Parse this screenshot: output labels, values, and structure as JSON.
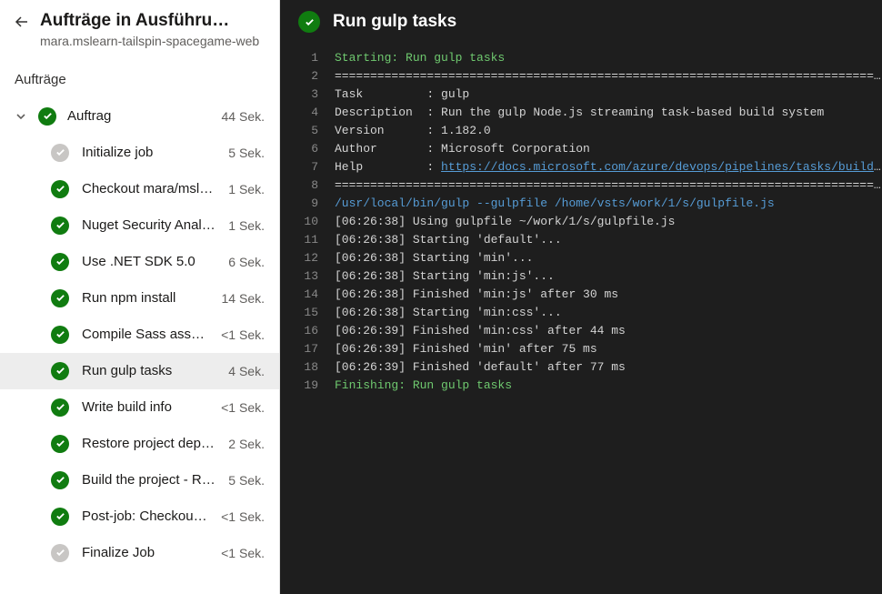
{
  "header": {
    "title": "Aufträge in Ausführu…",
    "subtitle": "mara.mslearn-tailspin-spacegame-web"
  },
  "sectionLabel": "Aufträge",
  "group": {
    "label": "Auftrag",
    "duration": "44 Sek."
  },
  "tasks": [
    {
      "label": "Initialize job",
      "duration": "5 Sek.",
      "status": "neutral",
      "selected": false
    },
    {
      "label": "Checkout mara/mslear…",
      "duration": "1 Sek.",
      "status": "success",
      "selected": false
    },
    {
      "label": "Nuget Security Analysi…",
      "duration": "1 Sek.",
      "status": "success",
      "selected": false
    },
    {
      "label": "Use .NET SDK 5.0",
      "duration": "6 Sek.",
      "status": "success",
      "selected": false
    },
    {
      "label": "Run npm install",
      "duration": "14 Sek.",
      "status": "success",
      "selected": false
    },
    {
      "label": "Compile Sass assets",
      "duration": "<1 Sek.",
      "status": "success",
      "selected": false
    },
    {
      "label": "Run gulp tasks",
      "duration": "4 Sek.",
      "status": "success",
      "selected": true
    },
    {
      "label": "Write build info",
      "duration": "<1 Sek.",
      "status": "success",
      "selected": false
    },
    {
      "label": "Restore project depen…",
      "duration": "2 Sek.",
      "status": "success",
      "selected": false
    },
    {
      "label": "Build the project - Rel…",
      "duration": "5 Sek.",
      "status": "success",
      "selected": false
    },
    {
      "label": "Post-job: Checkout t…",
      "duration": "<1 Sek.",
      "status": "success",
      "selected": false
    },
    {
      "label": "Finalize Job",
      "duration": "<1 Sek.",
      "status": "neutral",
      "selected": false
    }
  ],
  "log": {
    "title": "Run gulp tasks",
    "lines": [
      {
        "no": 1,
        "segs": [
          {
            "text": "Starting: Run gulp tasks",
            "cls": "tok-green"
          }
        ]
      },
      {
        "no": 2,
        "segs": [
          {
            "text": "==============================================================================",
            "cls": ""
          }
        ]
      },
      {
        "no": 3,
        "segs": [
          {
            "text": "Task         : gulp",
            "cls": ""
          }
        ]
      },
      {
        "no": 4,
        "segs": [
          {
            "text": "Description  : Run the gulp Node.js streaming task-based build system",
            "cls": ""
          }
        ]
      },
      {
        "no": 5,
        "segs": [
          {
            "text": "Version      : 1.182.0",
            "cls": ""
          }
        ]
      },
      {
        "no": 6,
        "segs": [
          {
            "text": "Author       : Microsoft Corporation",
            "cls": ""
          }
        ]
      },
      {
        "no": 7,
        "segs": [
          {
            "text": "Help         : ",
            "cls": ""
          },
          {
            "text": "https://docs.microsoft.com/azure/devops/pipelines/tasks/build/gulp",
            "cls": "tok-link"
          }
        ]
      },
      {
        "no": 8,
        "segs": [
          {
            "text": "==============================================================================",
            "cls": ""
          }
        ]
      },
      {
        "no": 9,
        "segs": [
          {
            "text": "/usr/local/bin/gulp --gulpfile /home/vsts/work/1/s/gulpfile.js",
            "cls": "tok-blue"
          }
        ]
      },
      {
        "no": 10,
        "segs": [
          {
            "text": "[06:26:38] Using gulpfile ~/work/1/s/gulpfile.js",
            "cls": ""
          }
        ]
      },
      {
        "no": 11,
        "segs": [
          {
            "text": "[06:26:38] Starting 'default'...",
            "cls": ""
          }
        ]
      },
      {
        "no": 12,
        "segs": [
          {
            "text": "[06:26:38] Starting 'min'...",
            "cls": ""
          }
        ]
      },
      {
        "no": 13,
        "segs": [
          {
            "text": "[06:26:38] Starting 'min:js'...",
            "cls": ""
          }
        ]
      },
      {
        "no": 14,
        "segs": [
          {
            "text": "[06:26:38] Finished 'min:js' after 30 ms",
            "cls": ""
          }
        ]
      },
      {
        "no": 15,
        "segs": [
          {
            "text": "[06:26:38] Starting 'min:css'...",
            "cls": ""
          }
        ]
      },
      {
        "no": 16,
        "segs": [
          {
            "text": "[06:26:39] Finished 'min:css' after 44 ms",
            "cls": ""
          }
        ]
      },
      {
        "no": 17,
        "segs": [
          {
            "text": "[06:26:39] Finished 'min' after 75 ms",
            "cls": ""
          }
        ]
      },
      {
        "no": 18,
        "segs": [
          {
            "text": "[06:26:39] Finished 'default' after 77 ms",
            "cls": ""
          }
        ]
      },
      {
        "no": 19,
        "segs": [
          {
            "text": "Finishing: Run gulp tasks",
            "cls": "tok-green"
          }
        ]
      }
    ]
  }
}
